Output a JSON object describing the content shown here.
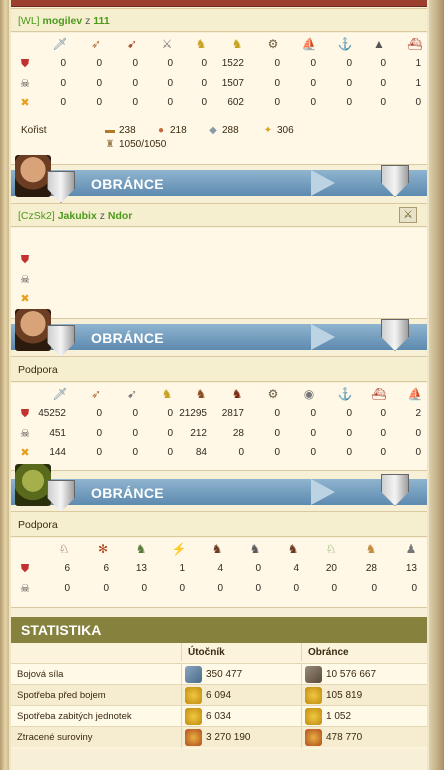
{
  "battle": {
    "attacker": {
      "tag": "[WL]",
      "name": "mogilev",
      "sep": "z",
      "town": "111",
      "unit_icons": [
        "sword-icon",
        "slinger-icon",
        "archer-icon",
        "hoplite-icon",
        "rider-icon",
        "chariot-icon",
        "catapult-icon",
        "trireme-icon",
        "colony-ship-icon",
        "fire-ship-icon",
        "bireme-icon"
      ],
      "rows": [
        {
          "icon": "shield-red-icon",
          "values": [
            "0",
            "0",
            "0",
            "0",
            "0",
            "1522",
            "0",
            "0",
            "0",
            "0",
            "1"
          ]
        },
        {
          "icon": "skull-icon",
          "values": [
            "0",
            "0",
            "0",
            "0",
            "0",
            "1507",
            "0",
            "0",
            "0",
            "0",
            "1"
          ]
        },
        {
          "icon": "cross-swords-icon",
          "values": [
            "0",
            "0",
            "0",
            "0",
            "0",
            "602",
            "0",
            "0",
            "0",
            "0",
            "0"
          ]
        }
      ],
      "loot_label": "Kořist",
      "loot": [
        {
          "icon": "wood-icon",
          "value": "238"
        },
        {
          "icon": "stone-icon",
          "value": "218"
        },
        {
          "icon": "silver-icon",
          "value": "288"
        },
        {
          "icon": "favor-icon",
          "value": "306"
        }
      ],
      "loot_capacity": "1050/1050"
    },
    "defenders": [
      {
        "title": "OBRÁNCE",
        "tag": "[CzSk2]",
        "name": "Jakubix",
        "sep": "z",
        "town": "Ndor"
      },
      {
        "title": "OBRÁNCE",
        "label": "Podpora",
        "unit_icons": [
          "sword-icon",
          "slinger-icon",
          "archer-icon",
          "hoplite-icon",
          "rider-icon",
          "chariot-icon",
          "catapult-icon",
          "trireme-icon",
          "colony-ship-icon",
          "fire-ship-icon",
          "bireme-icon"
        ],
        "rows": [
          {
            "icon": "shield-red-icon",
            "values": [
              "45252",
              "0",
              "0",
              "0",
              "21295",
              "2817",
              "0",
              "0",
              "0",
              "0",
              "2"
            ]
          },
          {
            "icon": "skull-icon",
            "values": [
              "451",
              "0",
              "0",
              "0",
              "212",
              "28",
              "0",
              "0",
              "0",
              "0",
              "0"
            ]
          },
          {
            "icon": "cross-swords-icon",
            "values": [
              "144",
              "0",
              "0",
              "0",
              "84",
              "0",
              "0",
              "0",
              "0",
              "0",
              "0"
            ]
          }
        ]
      },
      {
        "title": "OBRÁNCE",
        "label": "Podpora",
        "unit_icons": [
          "minotaur-icon",
          "manticore-icon",
          "cyclops-icon",
          "hydra-icon",
          "harpy-icon",
          "medusa-icon",
          "centaur-icon",
          "pegasus-icon",
          "cerberus-icon",
          "fury-icon",
          "griffin-icon"
        ],
        "rows": [
          {
            "icon": "shield-red-icon",
            "values": [
              "6",
              "6",
              "13",
              "1",
              "4",
              "0",
              "4",
              "20",
              "28",
              "13"
            ]
          },
          {
            "icon": "skull-icon",
            "values": [
              "0",
              "0",
              "0",
              "0",
              "0",
              "0",
              "0",
              "0",
              "0",
              "0"
            ]
          }
        ]
      }
    ]
  },
  "stats": {
    "title": "STATISTIKA",
    "col_attacker": "Útočník",
    "col_defender": "Obránce",
    "rows": [
      {
        "label": "Bojová síla",
        "a": "350 477",
        "b": "10 576 667",
        "a_icon": "swords-power-icon",
        "b_icon": "shield-power-icon"
      },
      {
        "label": "Spotřeba před bojem",
        "a": "6 094",
        "b": "105 819",
        "a_icon": "food-icon",
        "b_icon": "food-icon"
      },
      {
        "label": "Spotřeba zabitých jednotek",
        "a": "6 034",
        "b": "1 052",
        "a_icon": "food-icon",
        "b_icon": "food-icon"
      },
      {
        "label": "Ztracené suroviny",
        "a": "3 270 190",
        "b": "478 770",
        "a_icon": "resources-icon",
        "b_icon": "resources-icon"
      }
    ]
  },
  "colors": {
    "accent_green": "#4a9a1c",
    "band_blue": "#6f98ba",
    "stats_olive": "#86823e",
    "top_red": "#9c3f2e"
  }
}
